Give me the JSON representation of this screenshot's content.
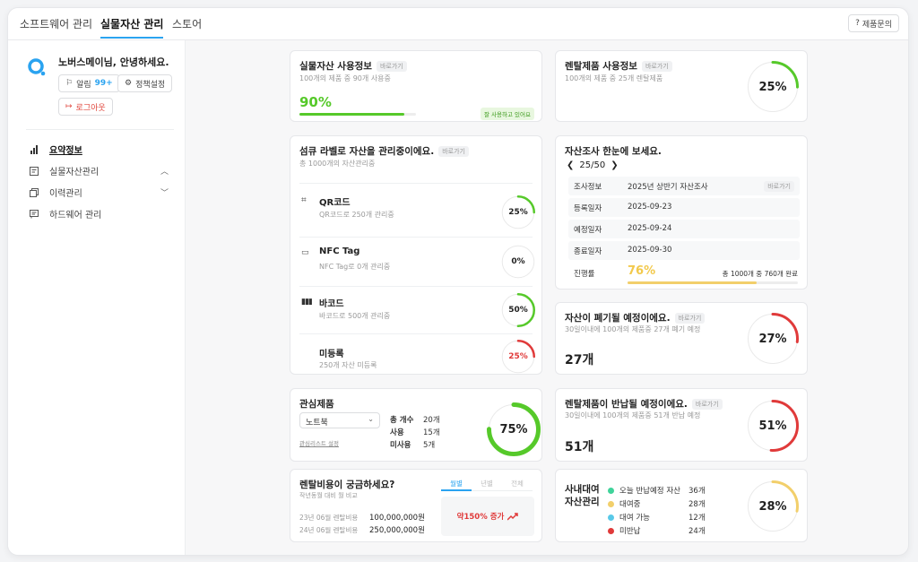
{
  "topbar": {
    "tabs": [
      "소프트웨어 관리",
      "실물자산 관리",
      "스토어"
    ],
    "inquiry_label": "제품문의"
  },
  "sidebar": {
    "greeting": "노버스메이님, 안녕하세요.",
    "alarm_label": "알림",
    "alarm_count": "99+",
    "policy_label": "정책설정",
    "logout_label": "로그아웃",
    "menu": [
      "요약정보",
      "실물자산관리",
      "이력관리",
      "하드웨어 관리"
    ]
  },
  "more_label": "바로가기",
  "asset_usage": {
    "title": "실물자산 사용정보",
    "subtitle": "100개의 제품 중 90개 사용중",
    "percent_text": "90%",
    "progress": 0.9,
    "badge": "잘 사용하고 있어요"
  },
  "rental_usage": {
    "title": "렌탈제품 사용정보",
    "subtitle": "100개의 제품 중 25개 렌탈제품",
    "percent_text": "25%",
    "value": 0.25
  },
  "label_mgmt": {
    "title": "섬큐 라벨로 자산을 관리중이에요.",
    "subtitle": "총 1000개의 자산관리중",
    "rows": [
      {
        "name": "QR코드",
        "sub": "QR코드로 250개 관리중",
        "percent_text": "25%",
        "value": 0.25
      },
      {
        "name": "NFC Tag",
        "sub": "NFC Tag로 0개 관리중",
        "percent_text": "0%",
        "value": 0
      },
      {
        "name": "바코드",
        "sub": "바코드로 500개 관리중",
        "percent_text": "50%",
        "value": 0.5
      },
      {
        "name": "미등록",
        "sub": "250개 자산 미등록",
        "percent_text": "25%",
        "value": 0.25
      }
    ]
  },
  "survey": {
    "title": "자산조사 한눈에 보세요.",
    "pager": "25/50",
    "rows": [
      {
        "k": "조사정보",
        "v": "2025년 상반기 자산조사"
      },
      {
        "k": "등록일자",
        "v": "2025-09-23"
      },
      {
        "k": "예정일자",
        "v": "2025-09-24"
      },
      {
        "k": "종료일자",
        "v": "2025-09-30"
      }
    ],
    "progress_label": "진행률",
    "progress_text": "76%",
    "progress": 0.76,
    "progress_note": "총 1000개 중 760개 완료"
  },
  "disposal": {
    "title": "자산이 폐기될 예정이에요.",
    "subtitle": "30일이내에 100개의 제품중 27개 폐기 예정",
    "count": "27개",
    "percent_text": "27%",
    "value": 0.27
  },
  "rental_return": {
    "title": "렌탈제품이 반납될 예정이에요.",
    "subtitle": "30일이내에 100개의 제품중 51개 반납 예정",
    "count": "51개",
    "percent_text": "51%",
    "value": 0.51
  },
  "interest": {
    "title": "관심제품",
    "select_value": "노트북",
    "link": "관심리스트 설정",
    "stats": [
      {
        "k": "총 개수",
        "v": "20개"
      },
      {
        "k": "사용",
        "v": "15개"
      },
      {
        "k": "미사용",
        "v": "5개"
      }
    ],
    "percent_text": "75%",
    "value": 0.75
  },
  "rental_cost": {
    "title": "렌탈비용이 궁금하세요?",
    "subtitle": "작년동월 대비 월 비교",
    "tabs": [
      "월별",
      "년별",
      "전체"
    ],
    "rows": [
      {
        "k": "23년 06월 렌탈비용",
        "v": "100,000,000원"
      },
      {
        "k": "24년 06월 렌탈비용",
        "v": "250,000,000원"
      }
    ],
    "increase": "약150% 증가"
  },
  "lending": {
    "title_line1": "사내대여",
    "title_line2": "자산관리",
    "legend": [
      {
        "label": "오늘 반납예정 자산",
        "value": "36개",
        "color": "#3fd39a"
      },
      {
        "label": "대여중",
        "value": "28개",
        "color": "#f2cf6b"
      },
      {
        "label": "대여 가능",
        "value": "12개",
        "color": "#59c9e8"
      },
      {
        "label": "미반납",
        "value": "24개",
        "color": "#e03a3a"
      }
    ],
    "percent_text": "28%",
    "value": 0.28
  },
  "colors": {
    "accent": "#2aa3f0",
    "green": "#56c92a",
    "red": "#e03a3a",
    "yellow": "#f2cf6b",
    "track": "#ededed"
  }
}
